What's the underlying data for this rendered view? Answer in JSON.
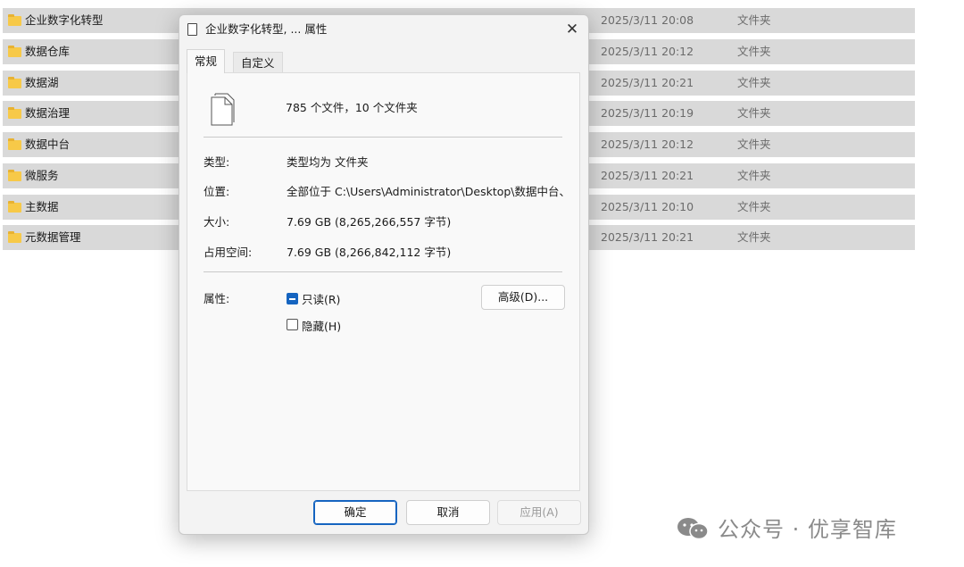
{
  "file_list": [
    {
      "name": "企业数字化转型",
      "date": "2025/3/11 20:08",
      "type": "文件夹"
    },
    {
      "name": "数据仓库",
      "date": "2025/3/11 20:12",
      "type": "文件夹"
    },
    {
      "name": "数据湖",
      "date": "2025/3/11 20:21",
      "type": "文件夹"
    },
    {
      "name": "数据治理",
      "date": "2025/3/11 20:19",
      "type": "文件夹"
    },
    {
      "name": "数据中台",
      "date": "2025/3/11 20:12",
      "type": "文件夹"
    },
    {
      "name": "微服务",
      "date": "2025/3/11 20:21",
      "type": "文件夹"
    },
    {
      "name": "主数据",
      "date": "2025/3/11 20:10",
      "type": "文件夹"
    },
    {
      "name": "元数据管理",
      "date": "2025/3/11 20:21",
      "type": "文件夹"
    }
  ],
  "dialog": {
    "title": "企业数字化转型, ... 属性",
    "close_glyph": "✕",
    "tabs": [
      "常规",
      "自定义"
    ],
    "summary": "785 个文件，10 个文件夹",
    "type_label": "类型:",
    "type_value": "类型均为 文件夹",
    "location_label": "位置:",
    "location_value": "全部位于 C:\\Users\\Administrator\\Desktop\\数据中台、",
    "size_label": "大小:",
    "size_value": "7.69 GB (8,265,266,557 字节)",
    "disk_label": "占用空间:",
    "disk_value": "7.69 GB (8,266,842,112 字节)",
    "attributes_label": "属性:",
    "readonly_label": "只读(R)",
    "readonly_checked": true,
    "hidden_label": "隐藏(H)",
    "hidden_checked": false,
    "advanced_button": "高级(D)...",
    "ok_button": "确定",
    "cancel_button": "取消",
    "apply_button": "应用(A)"
  },
  "watermark": {
    "text": "公众号 · 优享智库",
    "icon": "wechat-icon"
  },
  "colors": {
    "accent": "#1564c0",
    "row_bg": "#d9d9d9",
    "folder": "#f7c948",
    "dialog_bg": "#f3f3f3"
  }
}
